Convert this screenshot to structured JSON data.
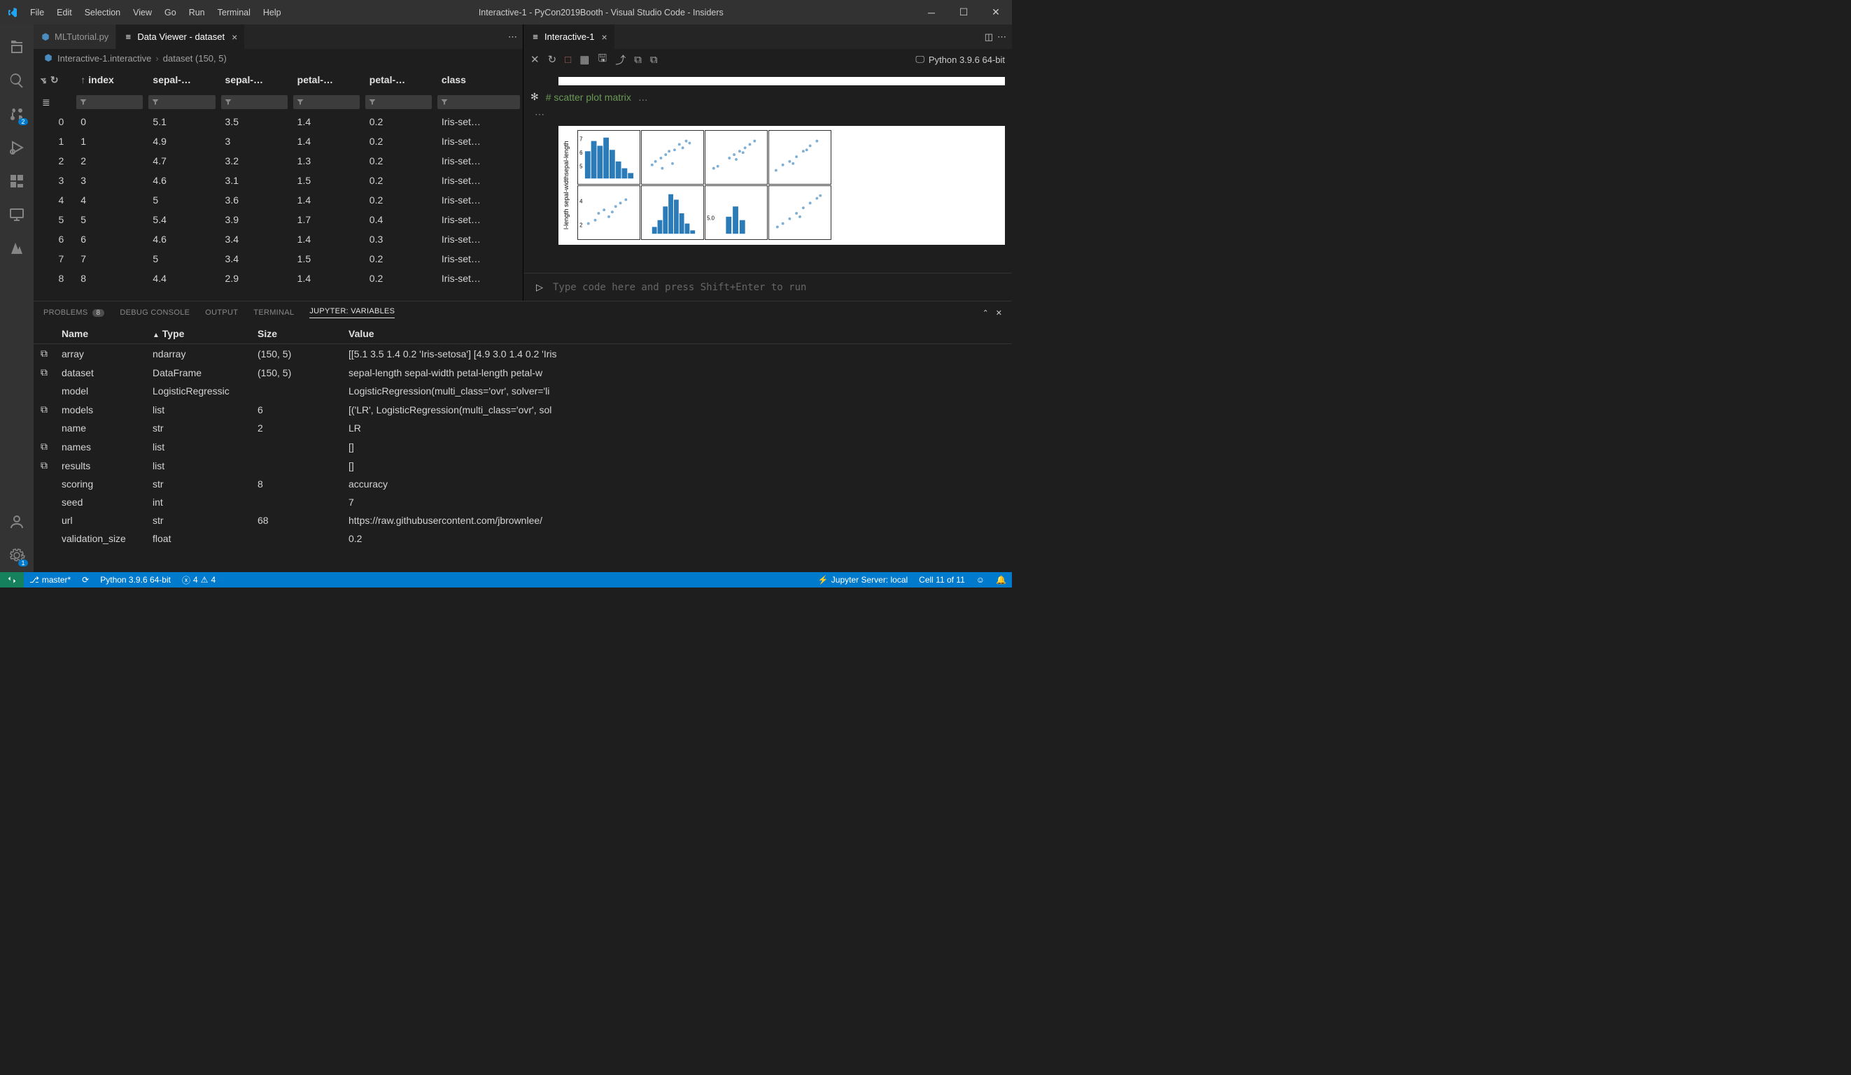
{
  "window": {
    "title": "Interactive-1 - PyCon2019Booth - Visual Studio Code - Insiders"
  },
  "menu": [
    "File",
    "Edit",
    "Selection",
    "View",
    "Go",
    "Run",
    "Terminal",
    "Help"
  ],
  "activity": {
    "scm_badge": "2",
    "settings_badge": "1"
  },
  "tabs_left": [
    {
      "label": "MLTutorial.py",
      "icon": "python",
      "active": false,
      "closable": false
    },
    {
      "label": "Data Viewer - dataset",
      "icon": "list",
      "active": true,
      "closable": true
    }
  ],
  "tabs_right": [
    {
      "label": "Interactive-1",
      "icon": "list",
      "active": true,
      "closable": true
    }
  ],
  "breadcrumb": {
    "seg1": "Interactive-1.interactive",
    "seg2": "dataset (150, 5)"
  },
  "breadcrumb_icon": "python",
  "dataviewer": {
    "columns": [
      "index",
      "sepal-…",
      "sepal-…",
      "petal-…",
      "petal-…",
      "class"
    ],
    "rows": [
      {
        "i": "0",
        "idx": "0",
        "c": [
          "5.1",
          "3.5",
          "1.4",
          "0.2",
          "Iris-set…"
        ]
      },
      {
        "i": "1",
        "idx": "1",
        "c": [
          "4.9",
          "3",
          "1.4",
          "0.2",
          "Iris-set…"
        ]
      },
      {
        "i": "2",
        "idx": "2",
        "c": [
          "4.7",
          "3.2",
          "1.3",
          "0.2",
          "Iris-set…"
        ]
      },
      {
        "i": "3",
        "idx": "3",
        "c": [
          "4.6",
          "3.1",
          "1.5",
          "0.2",
          "Iris-set…"
        ]
      },
      {
        "i": "4",
        "idx": "4",
        "c": [
          "5",
          "3.6",
          "1.4",
          "0.2",
          "Iris-set…"
        ]
      },
      {
        "i": "5",
        "idx": "5",
        "c": [
          "5.4",
          "3.9",
          "1.7",
          "0.4",
          "Iris-set…"
        ]
      },
      {
        "i": "6",
        "idx": "6",
        "c": [
          "4.6",
          "3.4",
          "1.4",
          "0.3",
          "Iris-set…"
        ]
      },
      {
        "i": "7",
        "idx": "7",
        "c": [
          "5",
          "3.4",
          "1.5",
          "0.2",
          "Iris-set…"
        ]
      },
      {
        "i": "8",
        "idx": "8",
        "c": [
          "4.4",
          "2.9",
          "1.4",
          "0.2",
          "Iris-set…"
        ]
      }
    ]
  },
  "interactive": {
    "kernel": "Python 3.9.6 64-bit",
    "comment": "# scatter plot matrix",
    "ellipsis": "…",
    "input_placeholder": "Type code here and press Shift+Enter to run",
    "ylabel": "l-length  sepal-widthsepal-length",
    "yticks_top": [
      "7",
      "6",
      "5"
    ],
    "yticks_mid": [
      "4",
      "2"
    ],
    "yticks_bot": [
      "5.0"
    ]
  },
  "panel": {
    "tabs": [
      {
        "label": "PROBLEMS",
        "badge": "8"
      },
      {
        "label": "DEBUG CONSOLE"
      },
      {
        "label": "OUTPUT"
      },
      {
        "label": "TERMINAL"
      },
      {
        "label": "JUPYTER: VARIABLES",
        "active": true
      }
    ],
    "headers": {
      "name": "Name",
      "type": "Type",
      "size": "Size",
      "value": "Value",
      "sort": "▲"
    },
    "rows": [
      {
        "exp": true,
        "name": "array",
        "type": "ndarray",
        "size": "(150, 5)",
        "value": "[[5.1 3.5 1.4 0.2 'Iris-setosa'] [4.9 3.0 1.4 0.2 'Iris"
      },
      {
        "exp": true,
        "name": "dataset",
        "type": "DataFrame",
        "size": "(150, 5)",
        "value": "sepal-length sepal-width petal-length petal-w"
      },
      {
        "exp": false,
        "name": "model",
        "type": "LogisticRegressic",
        "size": "",
        "value": "LogisticRegression(multi_class='ovr', solver='li"
      },
      {
        "exp": true,
        "name": "models",
        "type": "list",
        "size": "6",
        "value": "[('LR', LogisticRegression(multi_class='ovr', sol"
      },
      {
        "exp": false,
        "name": "name",
        "type": "str",
        "size": "2",
        "value": "LR"
      },
      {
        "exp": true,
        "name": "names",
        "type": "list",
        "size": "",
        "value": "[]"
      },
      {
        "exp": true,
        "name": "results",
        "type": "list",
        "size": "",
        "value": "[]"
      },
      {
        "exp": false,
        "name": "scoring",
        "type": "str",
        "size": "8",
        "value": "accuracy"
      },
      {
        "exp": false,
        "name": "seed",
        "type": "int",
        "size": "",
        "value": "7"
      },
      {
        "exp": false,
        "name": "url",
        "type": "str",
        "size": "68",
        "value": "https://raw.githubusercontent.com/jbrownlee/"
      },
      {
        "exp": false,
        "name": "validation_size",
        "type": "float",
        "size": "",
        "value": "0.2"
      }
    ]
  },
  "statusbar": {
    "branch": "master*",
    "python": "Python 3.9.6 64-bit",
    "errors": "4",
    "warnings": "4",
    "jupyter": "Jupyter Server: local",
    "cell": "Cell 11 of 11"
  }
}
